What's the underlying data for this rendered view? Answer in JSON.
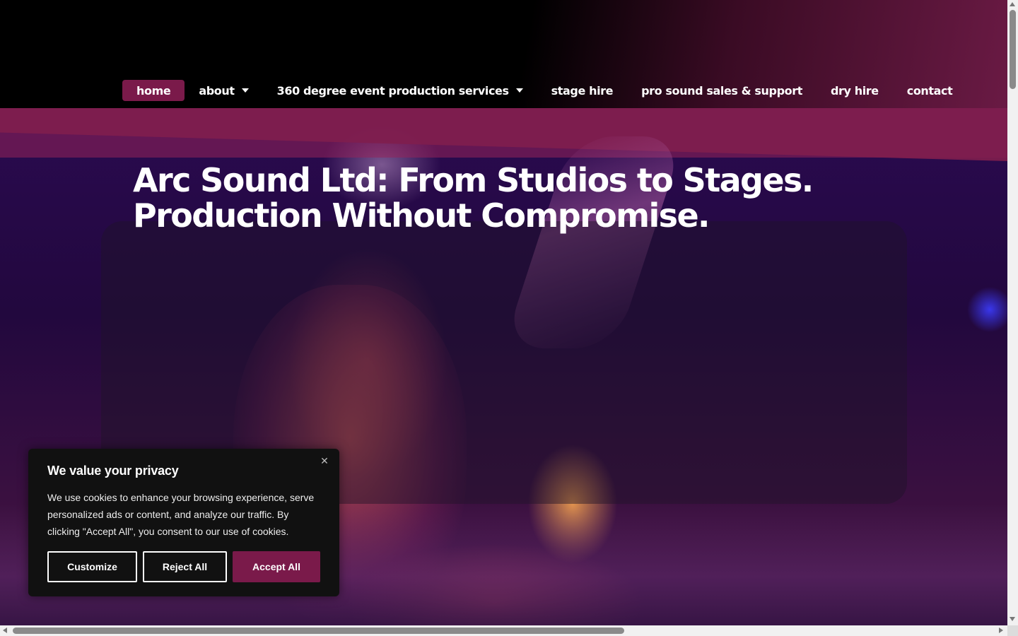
{
  "nav": {
    "items": [
      {
        "label": "home",
        "active": true,
        "dropdown": false
      },
      {
        "label": "about",
        "active": false,
        "dropdown": true
      },
      {
        "label": "360 degree event production services",
        "active": false,
        "dropdown": true
      },
      {
        "label": "stage hire",
        "active": false,
        "dropdown": false
      },
      {
        "label": "pro sound sales & support",
        "active": false,
        "dropdown": false
      },
      {
        "label": "dry hire",
        "active": false,
        "dropdown": false
      },
      {
        "label": "contact",
        "active": false,
        "dropdown": false
      }
    ],
    "dropdown_icon": "caret-down-icon"
  },
  "hero": {
    "headline_line1": "Arc Sound Ltd: From Studios to Stages.",
    "headline_line2": "Production Without Compromise."
  },
  "cookie_banner": {
    "title": "We value your privacy",
    "text": "We use cookies to enhance your browsing experience, serve personalized ads or content, and analyze our traffic. By clicking \"Accept All\", you consent to our use of cookies.",
    "close_icon": "close-icon",
    "customize_label": "Customize",
    "reject_label": "Reject All",
    "accept_label": "Accept All"
  },
  "colors": {
    "accent": "#7a1a4a",
    "header_bg": "#000000",
    "text": "#ffffff",
    "banner_bg": "#111111"
  }
}
